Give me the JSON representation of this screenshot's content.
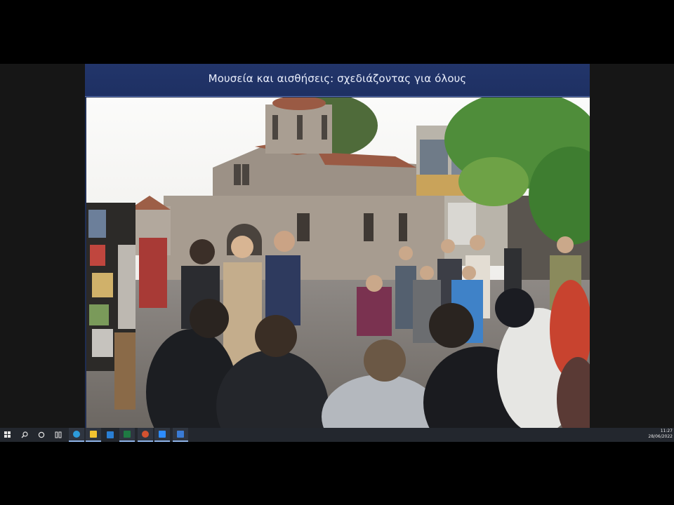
{
  "slide": {
    "title": "Μουσεία και αισθήσεις: σχεδιάζοντας για όλους"
  },
  "taskbar": {
    "icons": [
      "windows-start-icon",
      "search-icon",
      "cortana-icon",
      "task-view-icon",
      "edge-icon",
      "file-explorer-icon",
      "mail-icon",
      "excel-icon",
      "powerpoint-icon",
      "zoom-icon",
      "zoom-meetings-icon",
      "photos-icon"
    ],
    "colors": {
      "edge": "#2d9cdb",
      "explorer": "#f2c230",
      "mail": "#2a7fd4",
      "excel": "#1f7a43",
      "powerpoint": "#d35230",
      "zoom": "#2d8cff",
      "photos": "#3a7bd5"
    },
    "time": "11:27",
    "date": "28/06/2022"
  }
}
